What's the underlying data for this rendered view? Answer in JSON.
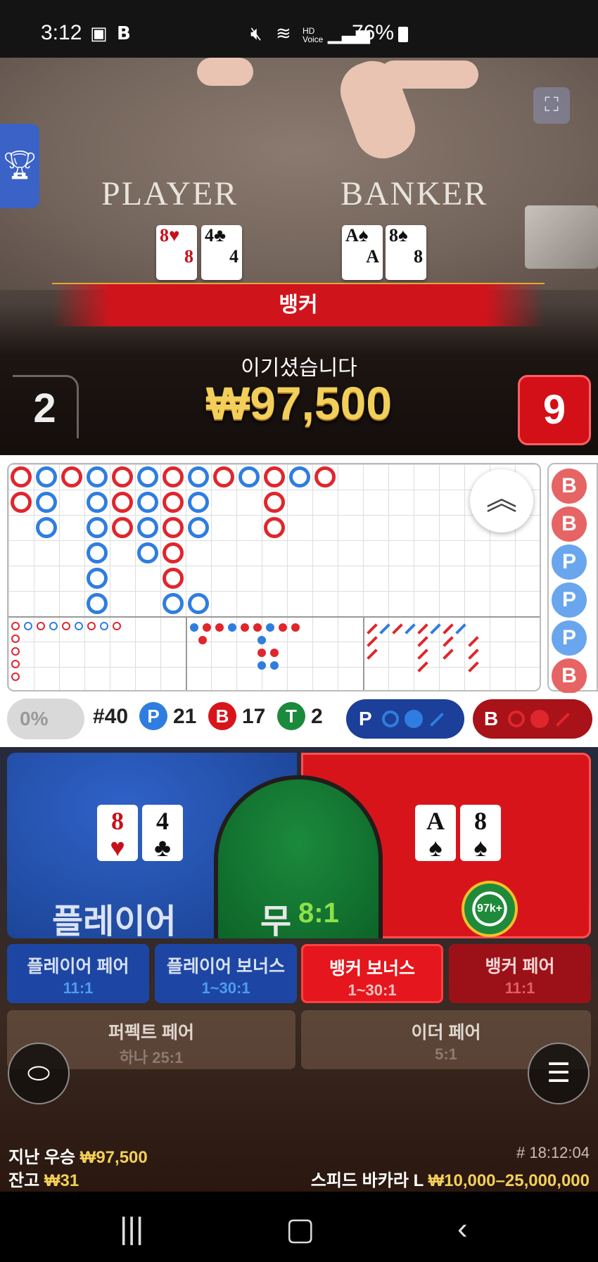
{
  "status_bar": {
    "time": "3:12",
    "battery": "76%"
  },
  "video": {
    "player_label": "PLAYER",
    "banker_label": "BANKER",
    "player_cards": [
      {
        "rank": "8",
        "suit": "♥",
        "color": "red"
      },
      {
        "rank": "4",
        "suit": "♣",
        "color": "black"
      }
    ],
    "banker_cards": [
      {
        "rank": "A",
        "suit": "♠",
        "color": "black"
      },
      {
        "rank": "8",
        "suit": "♠",
        "color": "black"
      }
    ],
    "result_banner": "뱅커",
    "win_text": "이기셨습니다",
    "win_amount": "₩97,500",
    "player_score": "2",
    "banker_score": "9"
  },
  "stats": {
    "percent": "0%",
    "round": "#40",
    "p_badge": "P",
    "p_count": "21",
    "b_badge": "B",
    "b_count": "17",
    "t_badge": "T",
    "t_count": "2",
    "p_pred_label": "P",
    "b_pred_label": "B"
  },
  "bead_road": [
    "B",
    "B",
    "P",
    "P",
    "P",
    "B"
  ],
  "bets": {
    "player": "플레이어",
    "tie": "무",
    "tie_odds": "8:1",
    "chip": "97k+",
    "player_pair": "플레이어 페어",
    "player_pair_odds": "11:1",
    "player_bonus": "플레이어 보너스",
    "player_bonus_odds": "1~30:1",
    "banker_bonus": "뱅커 보너스",
    "banker_bonus_odds": "1~30:1",
    "banker_pair": "뱅커 페어",
    "banker_pair_odds": "11:1",
    "perfect_pair": "퍼펙트 페어",
    "perfect_pair_odds": "하나 25:1",
    "either_pair": "이더 페어",
    "either_pair_odds": "5:1"
  },
  "footer": {
    "last_win_label": "지난 우승",
    "last_win": "₩97,500",
    "balance_label": "잔고",
    "balance": "₩31",
    "game_id": "# 18:12:04",
    "table_name": "스피드 바카라 L",
    "limits": "₩10,000–25,000,000"
  },
  "colors": {
    "banker": "#d8141b",
    "player": "#2f62c8",
    "tie": "#1b8a3c",
    "gold": "#f2cf5a"
  },
  "icons": [
    "image-icon",
    "b-app-icon",
    "mute-icon",
    "wifi-icon",
    "hd-voice-icon",
    "signal-icon",
    "battery-icon",
    "trophy-icon",
    "fullscreen-icon",
    "chevrons-up-icon",
    "chat-icon",
    "menu-icon",
    "recents-icon",
    "home-icon",
    "back-icon"
  ]
}
